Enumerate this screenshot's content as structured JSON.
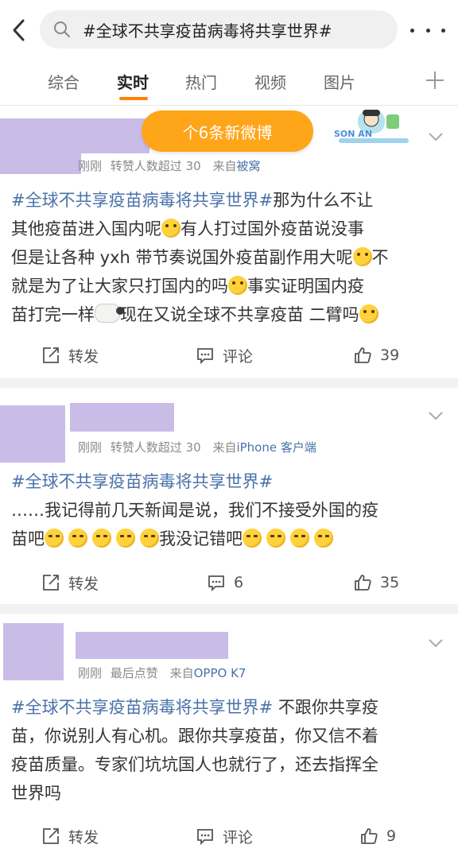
{
  "search": {
    "query": "#全球不共享疫苗病毒将共享世界#"
  },
  "tabs": [
    {
      "label": "综合"
    },
    {
      "label": "实时"
    },
    {
      "label": "热门"
    },
    {
      "label": "视频"
    },
    {
      "label": "图片"
    }
  ],
  "new_posts": {
    "label": "个6条新微博"
  },
  "badge_text": "SON  AN",
  "posts": [
    {
      "time": "刚刚",
      "info": "转赞人数超过 30",
      "from_prefix": "来自",
      "source": "被窝",
      "hashtag": "#全球不共享疫苗病毒将共享世界#",
      "line1": "那为什么不让",
      "line2a": "其他疫苗进入国内呢",
      "line2b": "有人打过国外疫苗说没事",
      "line3a": "但是让各种 yxh 带节奏说国外疫苗副作用大呢",
      "line3b": "不",
      "line4a": "就是为了让大家只打国内的吗",
      "line4b": "事实证明国内疫",
      "line5a": "苗打完一样",
      "line5b": "现在又说全球不共享疫苗 二臂吗",
      "repost": "转发",
      "comment": "评论",
      "likes": "39"
    },
    {
      "time": "刚刚",
      "info": "转赞人数超过 30",
      "from_prefix": "来自",
      "source": "iPhone 客户端",
      "hashtag": "#全球不共享疫苗病毒将共享世界#",
      "line1": "……我记得前几天新闻是说，我们不接受外国的疫",
      "line2a": "苗吧",
      "line2b": "我没记错吧",
      "repost": "转发",
      "comments": "6",
      "likes": "35"
    },
    {
      "time": "刚刚",
      "info": "最后点赞",
      "from_prefix": "来自",
      "source": "OPPO K7",
      "hashtag": "#全球不共享疫苗病毒将共享世界#",
      "line1": " 不跟你共享疫",
      "line2": "苗，你说别人有心机。跟你共享疫苗，你又信不着",
      "line3": "疫苗质量。专家们坑坑国人也就行了，还去指挥全",
      "line4": "世界吗",
      "repost": "转发",
      "comment": "评论",
      "likes": "9"
    }
  ]
}
